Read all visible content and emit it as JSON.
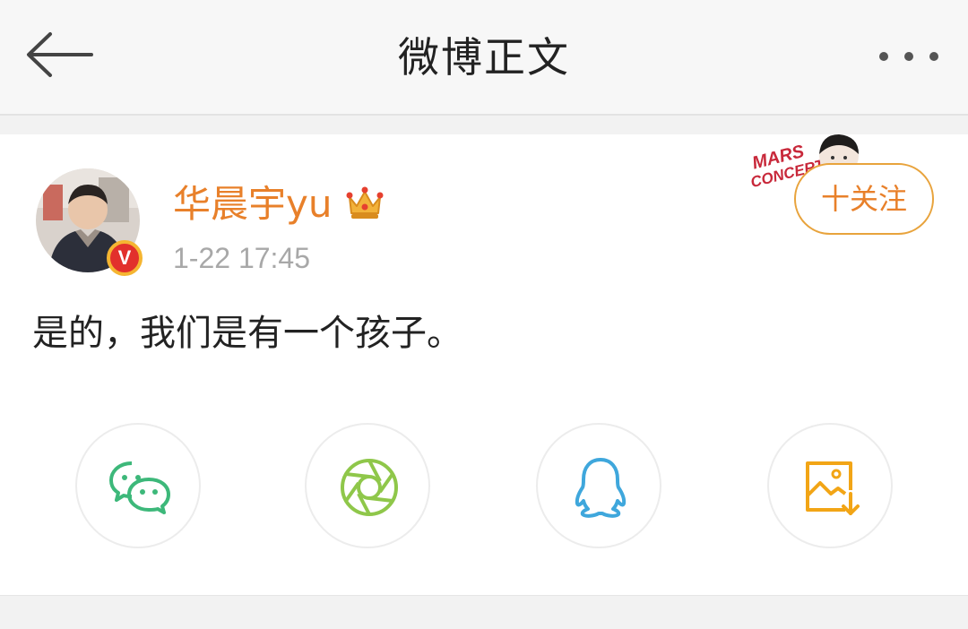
{
  "navbar": {
    "title": "微博正文",
    "back_icon": "arrow-left-icon",
    "more_icon": "more-dots-icon"
  },
  "post": {
    "username": "华晨宇yu",
    "verified_badge": "V",
    "timestamp": "1-22 17:45",
    "follow_label": "十关注",
    "content": "是的，我们是有一个孩子。",
    "username_color": "#e8802a",
    "follow_color": "#e8a33c"
  },
  "share_actions": [
    {
      "icon": "wechat-icon",
      "color": "#3db87a"
    },
    {
      "icon": "moments-icon",
      "color": "#8fc74a"
    },
    {
      "icon": "qq-icon",
      "color": "#3fa7dc"
    },
    {
      "icon": "save-image-icon",
      "color": "#f2a516"
    }
  ]
}
